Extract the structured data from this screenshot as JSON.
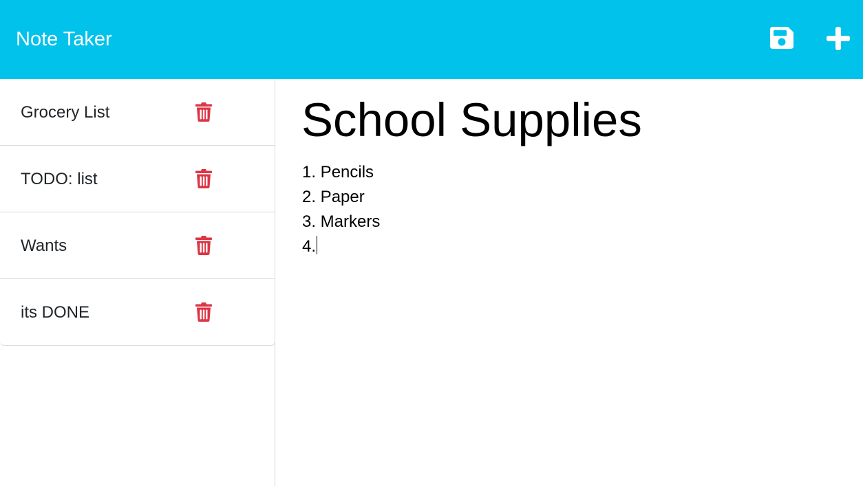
{
  "app": {
    "brand": "Note Taker",
    "brand_color": "#00c2eb",
    "icons": {
      "save": "floppy-disk-icon",
      "new": "plus-icon",
      "delete": "trash-icon"
    },
    "delete_color": "#dc3545"
  },
  "sidebar": {
    "notes": [
      {
        "title": "Grocery List"
      },
      {
        "title": "TODO: list"
      },
      {
        "title": "Wants"
      },
      {
        "title": "its DONE"
      }
    ]
  },
  "editor": {
    "title": "School Supplies",
    "body_lines": [
      "1. Pencils",
      "2. Paper",
      "3. Markers",
      "4."
    ]
  }
}
